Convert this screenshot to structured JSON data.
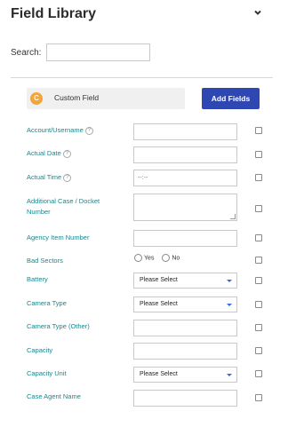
{
  "header": {
    "title": "Field Library",
    "collapse_icon": "chevron-down-icon"
  },
  "search": {
    "label": "Search:",
    "value": "",
    "placeholder": ""
  },
  "custom_field": {
    "badge": "C",
    "label": "Custom Field"
  },
  "add_fields_button": "Add Fields",
  "fields": [
    {
      "label": "Account/Username",
      "help": "?",
      "control": "text",
      "value": ""
    },
    {
      "label": "Actual Date",
      "help": "?",
      "control": "text",
      "value": ""
    },
    {
      "label": "Actual Time",
      "help": "?",
      "control": "text",
      "value": "",
      "placeholder": "--:--"
    },
    {
      "label": "Additional Case / Docket Number",
      "control": "textarea",
      "value": ""
    },
    {
      "label": "Agency Item Number",
      "control": "text",
      "value": ""
    },
    {
      "label": "Bad Sectors",
      "control": "radio",
      "options": [
        "Yes",
        "No"
      ]
    },
    {
      "label": "Battery",
      "control": "select",
      "value": "Please Select"
    },
    {
      "label": "Camera Type",
      "control": "select",
      "value": "Please Select"
    },
    {
      "label": "Camera Type (Other)",
      "control": "text",
      "value": ""
    },
    {
      "label": "Capacity",
      "control": "text",
      "value": ""
    },
    {
      "label": "Capacity Unit",
      "control": "select",
      "value": "Please Select"
    },
    {
      "label": "Case Agent Name",
      "control": "text",
      "value": ""
    }
  ],
  "colors": {
    "accent": "#2f47b3",
    "label": "#17878e",
    "badge": "#f2a53a"
  }
}
